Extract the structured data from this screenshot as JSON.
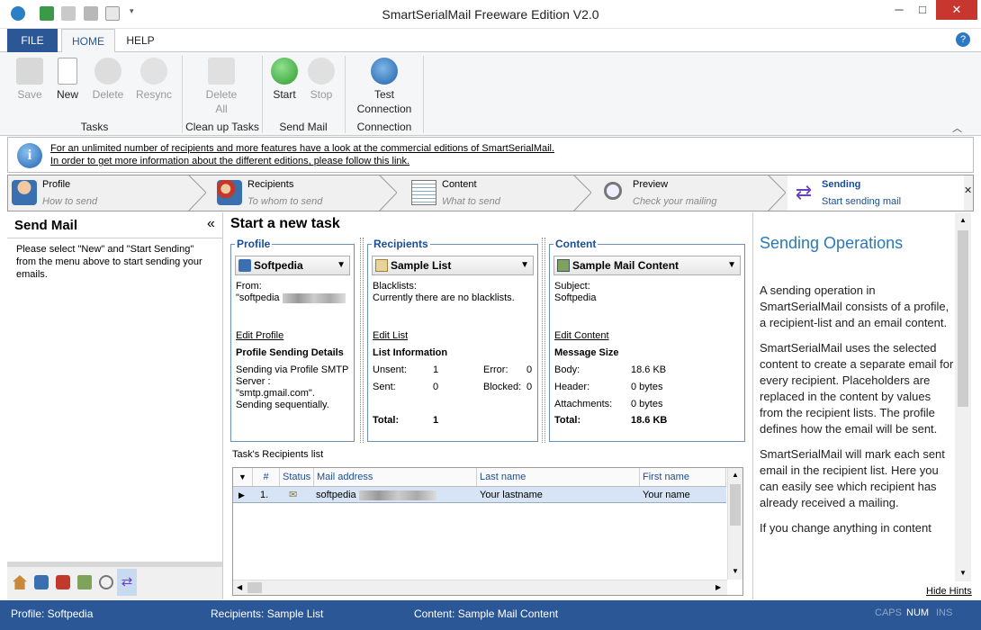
{
  "window": {
    "title": "SmartSerialMail Freeware Edition V2.0",
    "minimize": "─",
    "maximize": "□",
    "close": "✕"
  },
  "tabs": [
    "FILE",
    "HOME",
    "HELP"
  ],
  "ribbon": {
    "save": "Save",
    "new": "New",
    "delete": "Delete",
    "resync": "Resync",
    "delete_all_1": "Delete",
    "delete_all_2": "All",
    "start": "Start",
    "stop": "Stop",
    "test_conn_1": "Test",
    "test_conn_2": "Connection",
    "groups": {
      "tasks": "Tasks",
      "cleanup": "Clean up Tasks",
      "sendmail": "Send Mail",
      "connection": "Connection"
    }
  },
  "info": {
    "line1": "For an unlimited number of recipients and more features have a look at the commercial editions of SmartSerialMail.",
    "line2": "In order to get more information about the different editions, please follow this link."
  },
  "steps": [
    {
      "title": "Profile",
      "sub": "How to send"
    },
    {
      "title": "Recipients",
      "sub": "To whom to send"
    },
    {
      "title": "Content",
      "sub": "What to send"
    },
    {
      "title": "Preview",
      "sub": "Check your mailing"
    },
    {
      "title": "Sending",
      "sub": "Start sending mail"
    }
  ],
  "left": {
    "title": "Send Mail",
    "collapse": "«",
    "text": "Please select \"New\" and \"Start Sending\" from the menu above to start sending your emails."
  },
  "center": {
    "title": "Start a new task",
    "profile": {
      "legend": "Profile",
      "combo": "Softpedia",
      "from_label": "From:",
      "from_value": "\"softpedia",
      "edit": "Edit Profile",
      "details_title": "Profile Sending Details",
      "details_1": "Sending via Profile SMTP",
      "details_2": "Server :",
      "details_3": "\"smtp.gmail.com\".",
      "details_4": "Sending sequentially."
    },
    "recipients": {
      "legend": "Recipients",
      "combo": "Sample List",
      "bl_label": "Blacklists:",
      "bl_value": "Currently there are no blacklists.",
      "edit": "Edit List",
      "info_title": "List Information",
      "unsent_label": "Unsent:",
      "unsent": "1",
      "error_label": "Error:",
      "error": "0",
      "sent_label": "Sent:",
      "sent": "0",
      "blocked_label": "Blocked:",
      "blocked": "0",
      "total_label": "Total:",
      "total": "1"
    },
    "content": {
      "legend": "Content",
      "combo": "Sample Mail Content",
      "subject_label": "Subject:",
      "subject": "Softpedia",
      "edit": "Edit Content",
      "size_title": "Message Size",
      "body_label": "Body:",
      "body": "18.6 KB",
      "header_label": "Header:",
      "header": "0 bytes",
      "att_label": "Attachments:",
      "att": "0 bytes",
      "total_label": "Total:",
      "total": "18.6 KB"
    },
    "grid": {
      "caption": "Task's Recipients list",
      "columns": [
        "#",
        "Status",
        "Mail address",
        "Last name",
        "First name"
      ],
      "rows": [
        {
          "num": "1.",
          "mail": "softpedia",
          "last": "Your lastname",
          "first": "Your name"
        }
      ]
    }
  },
  "right": {
    "title": "Sending Operations",
    "p1": "A sending operation in SmartSerialMail consists of a profile, a recipient-list and an email content.",
    "p2": "SmartSerialMail uses the selected content to create a separate email for every recipient. Placeholders are replaced in the content by values from the recipient lists. The profile defines how the email will be sent.",
    "p3": "SmartSerialMail will mark each sent email in the recipient list. Here you can easily see which recipient has already received a mailing.",
    "p4": "If you change anything in content",
    "hide": "Hide Hints"
  },
  "status": {
    "profile": "Profile: Softpedia",
    "recipients": "Recipients: Sample List",
    "content": "Content: Sample Mail Content",
    "caps": "CAPS",
    "num": "NUM",
    "ins": "INS"
  },
  "colors": {
    "file_tab": "#2b5797",
    "status_bar": "#2b5797",
    "link_blue": "#1a4d96",
    "hint_title": "#2b78b8"
  }
}
